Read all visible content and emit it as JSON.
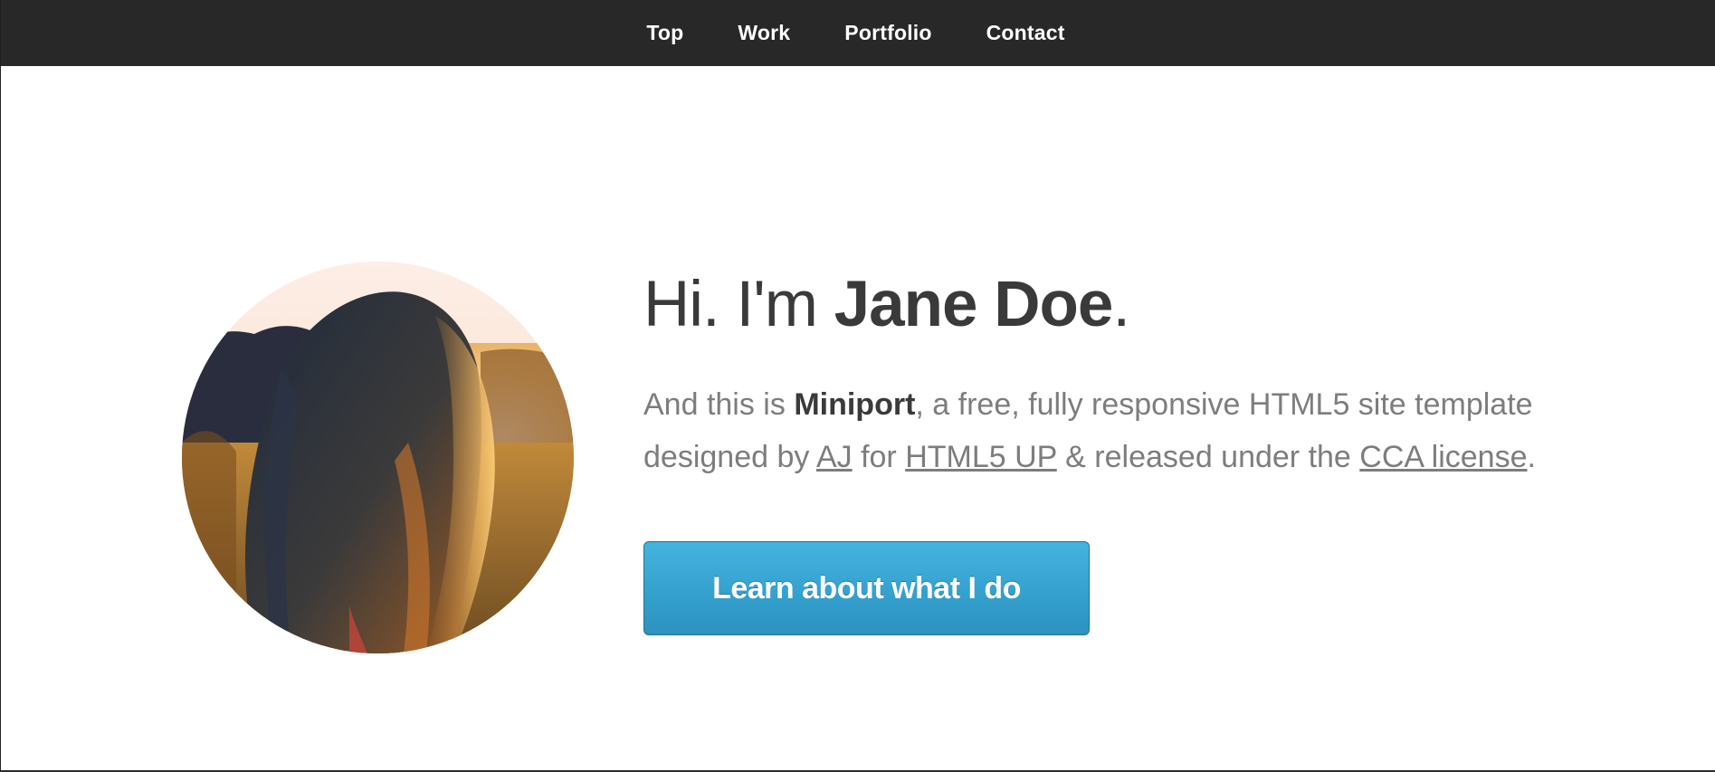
{
  "nav": {
    "items": [
      {
        "label": "Top"
      },
      {
        "label": "Work"
      },
      {
        "label": "Portfolio"
      },
      {
        "label": "Contact"
      }
    ]
  },
  "hero": {
    "greeting": "Hi. I'm ",
    "name": "Jane Doe",
    "greeting_end": ".",
    "intro": {
      "part1": "And this is ",
      "site_name": "Miniport",
      "part2": ", a free, fully responsive HTML5 site template",
      "part3": "designed by ",
      "link_author": "AJ",
      "part4": " for ",
      "link_site": "HTML5 UP",
      "part5": " & released under the ",
      "link_license": "CCA license",
      "part6": "."
    },
    "button_label": "Learn about what I do"
  },
  "colors": {
    "nav_background": "#282828",
    "accent": "#3aa8d6",
    "text_dark": "#3a3a3a",
    "text_muted": "#7d7d7d"
  }
}
